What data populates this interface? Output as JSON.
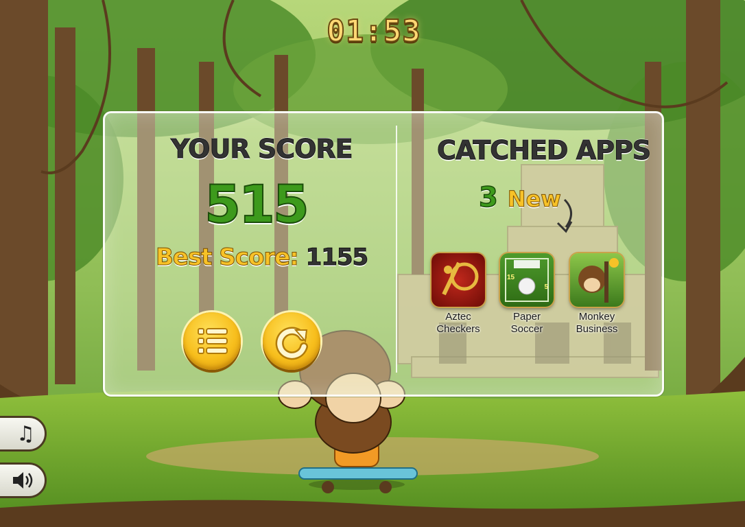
{
  "timer": "01:53",
  "score_panel": {
    "heading": "YOUR SCORE",
    "score": "515",
    "best_label": "Best Score:",
    "best_value": "1155"
  },
  "apps_panel": {
    "heading": "CATCHED APPS",
    "new_count": "3",
    "new_label": "New",
    "apps": [
      {
        "label": "Aztec\nCheckers",
        "icon": "aztec-checkers-icon"
      },
      {
        "label": "Paper\nSoccer",
        "icon": "paper-soccer-icon"
      },
      {
        "label": "Monkey\nBusiness",
        "icon": "monkey-business-icon"
      }
    ],
    "soccer_score_left": "15",
    "soccer_score_right": "5"
  },
  "buttons": {
    "menu_icon": "list-icon",
    "replay_icon": "replay-icon",
    "music_icon": "music-note-icon",
    "sound_icon": "speaker-icon"
  },
  "colors": {
    "score_green": "#3d9a1c",
    "gold": "#f7c228",
    "panel_border": "#ffffff"
  }
}
